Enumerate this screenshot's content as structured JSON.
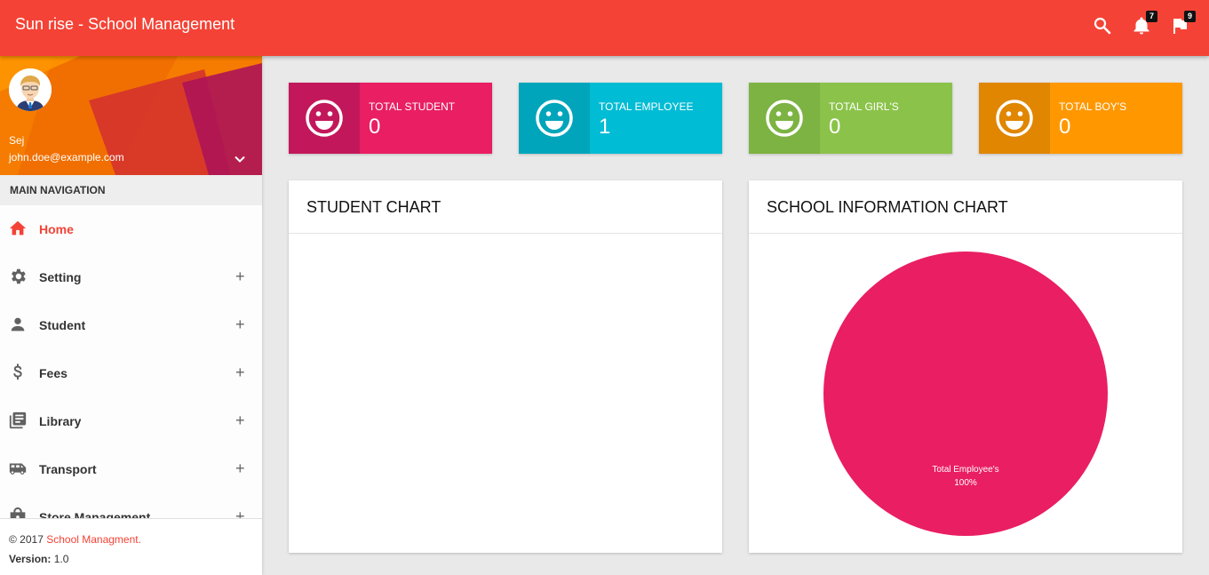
{
  "app": {
    "title": "Sun rise - School Management"
  },
  "topbar": {
    "search_icon": "search-icon",
    "notifications": {
      "icon": "bell-icon",
      "count": "7"
    },
    "flags": {
      "icon": "flag-icon",
      "count": "9"
    }
  },
  "user": {
    "name": "Sej",
    "email": "john.doe@example.com"
  },
  "nav": {
    "header": "MAIN NAVIGATION",
    "items": [
      {
        "label": "Home",
        "icon": "home-icon",
        "active": true
      },
      {
        "label": "Setting",
        "icon": "gear-icon",
        "expand": "+"
      },
      {
        "label": "Student",
        "icon": "person-icon",
        "expand": "+"
      },
      {
        "label": "Fees",
        "icon": "dollar-icon",
        "expand": "+"
      },
      {
        "label": "Library",
        "icon": "library-icon",
        "expand": "+"
      },
      {
        "label": "Transport",
        "icon": "bus-icon",
        "expand": "+"
      },
      {
        "label": "Store Management",
        "icon": "store-icon",
        "expand": "+"
      }
    ]
  },
  "footer": {
    "copyright": "© 2017 ",
    "brand": "School Managment",
    "dot": ".",
    "version_label": "Version:",
    "version": " 1.0"
  },
  "stats": [
    {
      "label": "TOTAL STUDENT",
      "value": "0",
      "icon": "smiley-icon",
      "color": "#e91e63",
      "icon_bg": "#c2185b"
    },
    {
      "label": "TOTAL EMPLOYEE",
      "value": "1",
      "icon": "smiley-icon",
      "color": "#00bcd4",
      "icon_bg": "#00a5bb"
    },
    {
      "label": "TOTAL GIRL'S",
      "value": "0",
      "icon": "smiley-icon",
      "color": "#8bc34a",
      "icon_bg": "#7cb342"
    },
    {
      "label": "TOTAL BOY'S",
      "value": "0",
      "icon": "smiley-icon",
      "color": "#ff9800",
      "icon_bg": "#e08600"
    }
  ],
  "student_chart": {
    "title": "STUDENT CHART"
  },
  "school_chart": {
    "title": "SCHOOL INFORMATION CHART"
  },
  "chart_data": {
    "type": "pie",
    "slices": [
      {
        "label": "Total Employee's",
        "value": 100,
        "display": "100%",
        "color": "#e91e63"
      }
    ]
  }
}
